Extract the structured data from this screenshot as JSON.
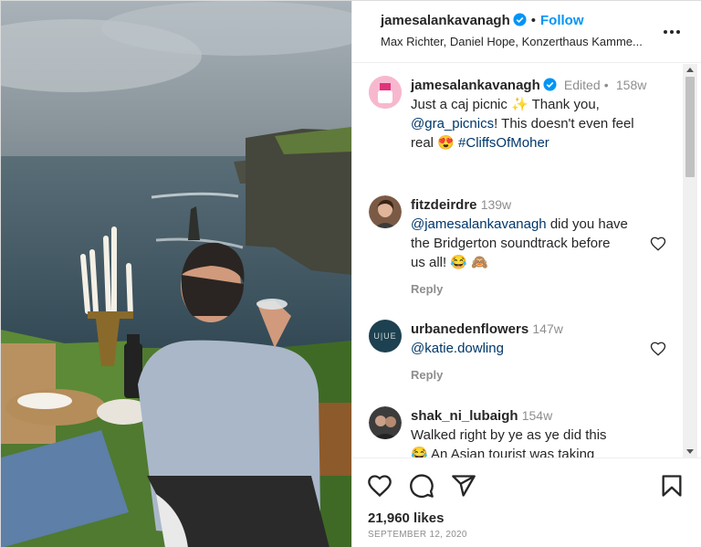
{
  "header": {
    "username": "james­alankavanagh",
    "username_plain": "jamesalankavanagh",
    "separator": "•",
    "follow_label": "Follow",
    "audio": "Max Richter, Daniel Hope, Konzerthaus Kamme..."
  },
  "caption": {
    "username": "jamesalankavanagh",
    "edited": "Edited",
    "sep": "•",
    "time": "158w",
    "text_1": "Just a caj picnic ✨ Thank you,",
    "mention": "@gra_picnics",
    "text_2": "! This doesn't even feel",
    "text_3": "real 😍 ",
    "hashtag": "#CliffsOfMoher"
  },
  "comments": [
    {
      "username": "fitzdeirdre",
      "time": "139w",
      "mention": "@jamesalankavanagh",
      "text_1": " did you have",
      "text_2": "the Bridgerton soundtrack before",
      "text_3": "us all! 😂 🙈",
      "reply": "Reply"
    },
    {
      "username": "urbanedenflowers",
      "time": "147w",
      "mention": "@katie.dowling",
      "reply": "Reply",
      "avatar_text": "U|UE"
    },
    {
      "username": "shak_ni_lubaigh",
      "time": "154w",
      "text_1": "Walked right by ye as ye did this",
      "text_2": "😂 An Asian tourist was taking"
    }
  ],
  "footer": {
    "likes": "21,960 likes",
    "date": "SEPTEMBER 12, 2020"
  },
  "colors": {
    "accent": "#0095f6",
    "link": "#00376b",
    "muted": "#8e8e8e",
    "text": "#262626"
  }
}
